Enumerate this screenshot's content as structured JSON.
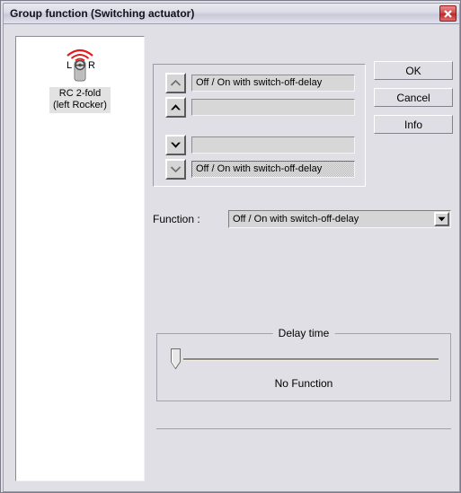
{
  "window": {
    "title": "Group function (Switching actuator)",
    "close_icon": "close-icon"
  },
  "tree": {
    "device": {
      "icon": "remote-control-icon",
      "left_key_label": "L",
      "right_key_label": "R",
      "name_line1": "RC 2-fold",
      "name_line2": "(left Rocker)"
    }
  },
  "function_list": {
    "rows": [
      {
        "icon": "chevron-up-outline-icon",
        "value": "Off / On with switch-off-delay",
        "selected": false
      },
      {
        "icon": "chevron-up-filled-icon",
        "value": "",
        "selected": false
      },
      {
        "icon": "chevron-down-filled-icon",
        "value": "",
        "selected": false
      },
      {
        "icon": "chevron-down-outline-icon",
        "value": "Off / On with switch-off-delay",
        "selected": true
      }
    ]
  },
  "function_select": {
    "label": "Function :",
    "value": "Off / On with switch-off-delay",
    "arrow_icon": "chevron-down-icon"
  },
  "buttons": {
    "ok": "OK",
    "cancel": "Cancel",
    "info": "Info"
  },
  "delay_time": {
    "legend": "Delay time",
    "slider_value_percent": 0,
    "status": "No Function"
  },
  "colors": {
    "dialog_face": "#dfdfe5",
    "title_bar": "#dcdce7",
    "close_button": "#c22626",
    "radio_wave": "#e01b1b",
    "selection_pattern": "#b9b9b9"
  }
}
